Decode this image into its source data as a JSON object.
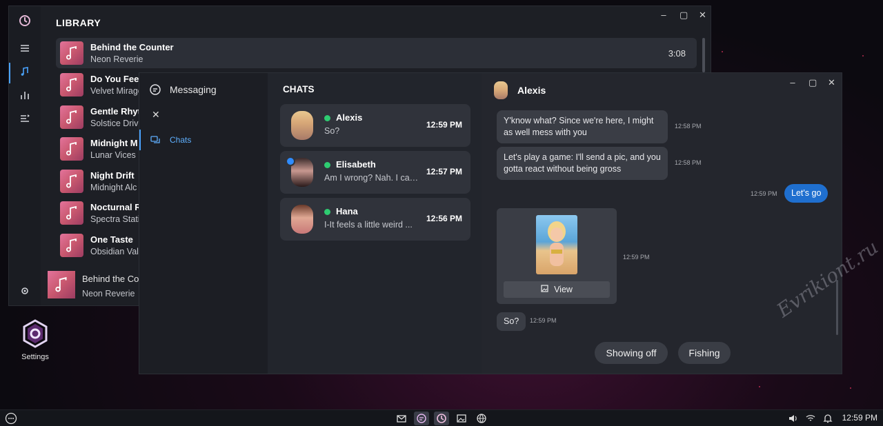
{
  "desktop": {
    "settings_label": "Settings",
    "watermark": "Evrikiont.ru"
  },
  "music": {
    "library_title": "LIBRARY",
    "tracks": [
      {
        "title": "Behind the Counter",
        "artist": "Neon Reverie",
        "duration": "3:08"
      },
      {
        "title": "Do You Feel",
        "artist": "Velvet Mirage"
      },
      {
        "title": "Gentle Rhyt",
        "artist": "Solstice Driv"
      },
      {
        "title": "Midnight M",
        "artist": "Lunar Vices"
      },
      {
        "title": "Night Drift",
        "artist": "Midnight Alc"
      },
      {
        "title": "Nocturnal Rh",
        "artist": "Spectra Stati"
      },
      {
        "title": "One Taste",
        "artist": "Obsidian Val"
      }
    ],
    "now_playing": {
      "title": "Behind the Co",
      "artist": "Neon Reverie"
    }
  },
  "messaging": {
    "app_title": "Messaging",
    "nav_chats": "Chats",
    "list_header": "CHATS",
    "chats": [
      {
        "name": "Alexis",
        "preview": "So?",
        "time": "12:59 PM"
      },
      {
        "name": "Elisabeth",
        "preview": "Am I wrong? Nah. I can...",
        "time": "12:57 PM"
      },
      {
        "name": "Hana",
        "preview": "I-It feels a little weird ...",
        "time": "12:56 PM"
      }
    ],
    "conversation": {
      "contact": "Alexis",
      "messages": [
        {
          "text": "Y'know what? Since we're here, I might as well mess with you",
          "time": "12:58 PM"
        },
        {
          "text": "Let's play a game: I'll send a pic, and you gotta react without being gross",
          "time": "12:58 PM"
        },
        {
          "text": "Let's go",
          "time": "12:59 PM"
        },
        {
          "image_button": "View",
          "time": "12:59 PM"
        },
        {
          "text": "So?",
          "time": "12:59 PM"
        }
      ],
      "quick_replies": [
        "Showing off",
        "Fishing"
      ]
    }
  },
  "taskbar": {
    "clock": "12:59 PM"
  },
  "colors": {
    "accent": "#4aa3ff",
    "online": "#2ecc71",
    "outgoing": "#1f6fcf"
  }
}
